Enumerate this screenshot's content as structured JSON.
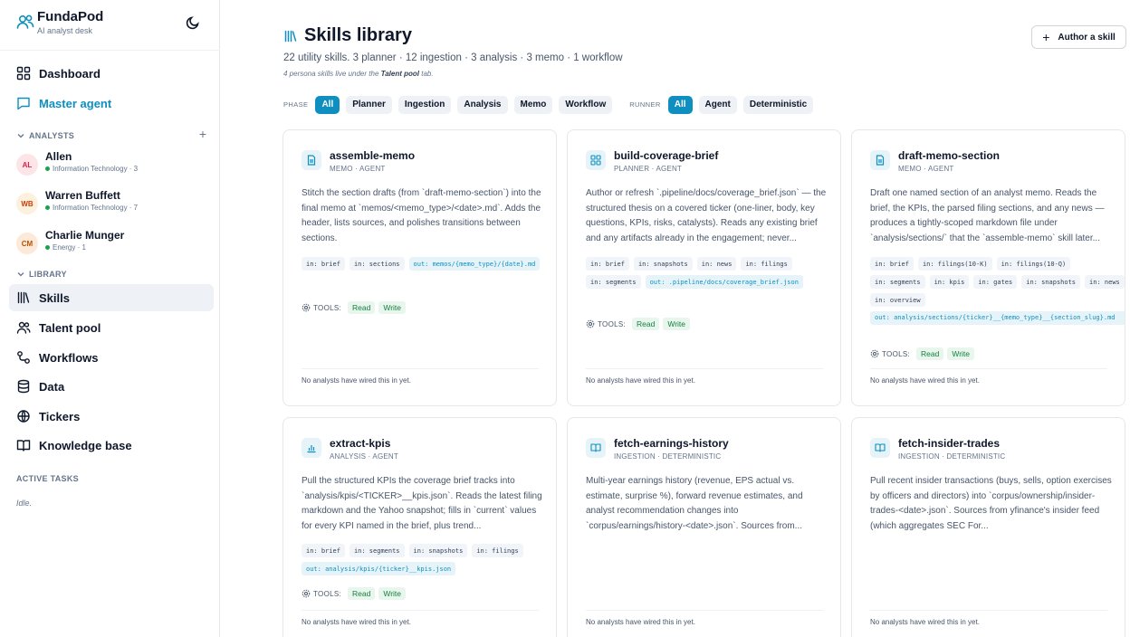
{
  "brand": {
    "name": "FundaPod",
    "subtitle": "AI analyst desk"
  },
  "nav": {
    "dashboard": "Dashboard",
    "master_agent": "Master agent",
    "analysts_label": "ANALYSTS",
    "library_label": "LIBRARY",
    "skills": "Skills",
    "talent_pool": "Talent pool",
    "workflows": "Workflows",
    "data": "Data",
    "tickers": "Tickers",
    "knowledge_base": "Knowledge base",
    "active_tasks_label": "ACTIVE TASKS",
    "idle": "Idle."
  },
  "analysts": [
    {
      "initials": "AL",
      "name": "Allen",
      "meta": "Information Technology · 3",
      "avatar_bg": "#fde4e7",
      "avatar_fg": "#e11d48"
    },
    {
      "initials": "WB",
      "name": "Warren Buffett",
      "meta": "Information Technology · 7",
      "avatar_bg": "#fdf0dc",
      "avatar_fg": "#c2410c"
    },
    {
      "initials": "CM",
      "name": "Charlie Munger",
      "meta": "Energy · 1",
      "avatar_bg": "#fde9d7",
      "avatar_fg": "#b45309"
    }
  ],
  "page": {
    "title": "Skills library",
    "subtitle": "22 utility skills. 3 planner · 12 ingestion · 3 analysis · 3 memo · 1 workflow",
    "note_prefix": "4 persona skills live under the ",
    "note_link": "Talent pool",
    "note_suffix": " tab.",
    "author_button": "Author a skill"
  },
  "filters": {
    "phase_label": "PHASE",
    "phase": [
      "All",
      "Planner",
      "Ingestion",
      "Analysis",
      "Memo",
      "Workflow"
    ],
    "runner_label": "RUNNER",
    "runner": [
      "All",
      "Agent",
      "Deterministic"
    ]
  },
  "tools_label": "TOOLS:",
  "cards": [
    {
      "name": "assemble-memo",
      "meta": "MEMO · AGENT",
      "icon": "document-icon",
      "desc": "Stitch the section drafts (from `draft-memo-section`) into the final memo at `memos/<memo_type>/<date>.md`. Adds the header, lists sources, and polishes transitions between sections.",
      "inputs": [
        "in: brief",
        "in: sections"
      ],
      "output": "out: memos/{memo_type}/{date}.md",
      "tools": [
        "Read",
        "Write"
      ],
      "footer": "No analysts have wired this in yet."
    },
    {
      "name": "build-coverage-brief",
      "meta": "PLANNER · AGENT",
      "icon": "grid-icon",
      "desc": "Author or refresh `.pipeline/docs/coverage_brief.json` — the structured thesis on a covered ticker (one-liner, body, key questions, KPIs, risks, catalysts). Reads any existing brief and any artifacts already in the engagement; never...",
      "inputs": [
        "in: brief",
        "in: snapshots",
        "in: news",
        "in: filings",
        "in: segments"
      ],
      "output": "out: .pipeline/docs/coverage_brief.json",
      "tools": [
        "Read",
        "Write"
      ],
      "footer": "No analysts have wired this in yet."
    },
    {
      "name": "draft-memo-section",
      "meta": "MEMO · AGENT",
      "icon": "document-icon",
      "desc": "Draft one named section of an analyst memo. Reads the brief, the KPIs, the parsed filing sections, and any news — produces a tightly-scoped markdown file under `analysis/sections/` that the `assemble-memo` skill later...",
      "inputs": [
        "in: brief",
        "in: filings(10-K)",
        "in: filings(10-Q)",
        "in: segments",
        "in: kpis",
        "in: gates",
        "in: snapshots",
        "in: news",
        "in: overview"
      ],
      "output": "out: analysis/sections/{ticker}__{memo_type}__{section_slug}.md",
      "tools": [
        "Read",
        "Write"
      ],
      "footer": "No analysts have wired this in yet."
    },
    {
      "name": "extract-kpis",
      "meta": "ANALYSIS · AGENT",
      "icon": "bar-chart-icon",
      "desc": "Pull the structured KPIs the coverage brief tracks into `analysis/kpis/<TICKER>__kpis.json`. Reads the latest filing markdown and the Yahoo snapshot; fills in `current` values for every KPI named in the brief, plus trend...",
      "inputs": [
        "in: brief",
        "in: segments",
        "in: snapshots",
        "in: filings"
      ],
      "output": "out: analysis/kpis/{ticker}__kpis.json",
      "tools": [
        "Read",
        "Write"
      ],
      "footer": "No analysts have wired this in yet."
    },
    {
      "name": "fetch-earnings-history",
      "meta": "INGESTION · DETERMINISTIC",
      "icon": "book-icon",
      "desc": "Multi-year earnings history (revenue, EPS actual vs. estimate, surprise %), forward revenue estimates, and analyst recommendation changes into `corpus/earnings/history-<date>.json`. Sources from...",
      "inputs": [],
      "output": "",
      "tools": [],
      "footer": "No analysts have wired this in yet."
    },
    {
      "name": "fetch-insider-trades",
      "meta": "INGESTION · DETERMINISTIC",
      "icon": "book-icon",
      "desc": "Pull recent insider transactions (buys, sells, option exercises by officers and directors) into `corpus/ownership/insider-trades-<date>.json`. Sources from yfinance's insider feed (which aggregates SEC For...",
      "inputs": [],
      "output": "",
      "tools": [],
      "footer": "No analysts have wired this in yet."
    }
  ]
}
